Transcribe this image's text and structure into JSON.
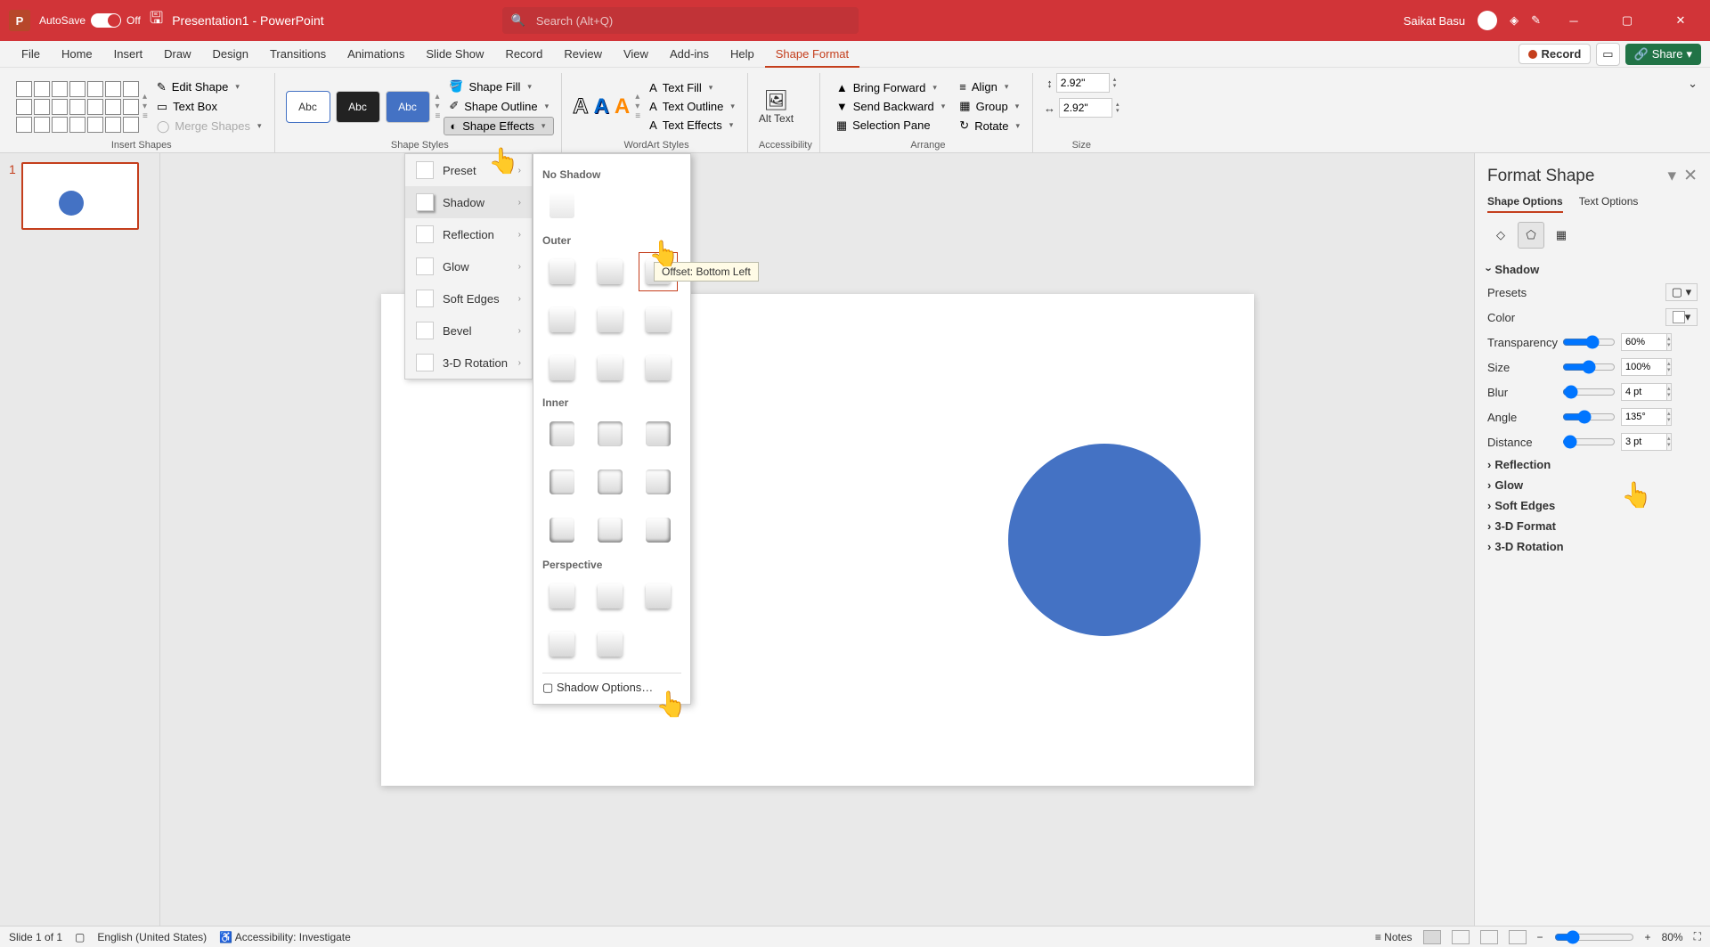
{
  "titlebar": {
    "autosave": "AutoSave",
    "autosave_state": "Off",
    "doc": "Presentation1  -  PowerPoint",
    "search_placeholder": "Search (Alt+Q)",
    "user": "Saikat Basu"
  },
  "tabs": {
    "file": "File",
    "home": "Home",
    "insert": "Insert",
    "draw": "Draw",
    "design": "Design",
    "transitions": "Transitions",
    "animations": "Animations",
    "slideshow": "Slide Show",
    "record": "Record",
    "review": "Review",
    "view": "View",
    "addins": "Add-ins",
    "help": "Help",
    "shapeformat": "Shape Format",
    "record_btn": "Record",
    "share_btn": "Share"
  },
  "ribbon": {
    "insert_shapes": "Insert Shapes",
    "edit_shape": "Edit Shape",
    "text_box": "Text Box",
    "merge_shapes": "Merge Shapes",
    "shape_styles": "Shape Styles",
    "shape_fill": "Shape Fill",
    "shape_outline": "Shape Outline",
    "shape_effects": "Shape Effects",
    "abc": "Abc",
    "wordart_styles": "WordArt Styles",
    "text_fill": "Text Fill",
    "text_outline": "Text Outline",
    "text_effects": "Text Effects",
    "accessibility": "Accessibility",
    "alt_text": "Alt Text",
    "arrange": "Arrange",
    "bring_forward": "Bring Forward",
    "send_backward": "Send Backward",
    "selection_pane": "Selection Pane",
    "align": "Align",
    "group": "Group",
    "rotate": "Rotate",
    "size": "Size",
    "height": "2.92\"",
    "width": "2.92\""
  },
  "fx_menu": {
    "preset": "Preset",
    "shadow": "Shadow",
    "reflection": "Reflection",
    "glow": "Glow",
    "soft_edges": "Soft Edges",
    "bevel": "Bevel",
    "rotation_3d": "3-D Rotation"
  },
  "shadow_panel": {
    "no_shadow": "No Shadow",
    "outer": "Outer",
    "inner": "Inner",
    "perspective": "Perspective",
    "shadow_options": "Shadow Options…",
    "tooltip": "Offset: Bottom Left"
  },
  "format_pane": {
    "title": "Format Shape",
    "shape_options": "Shape Options",
    "text_options": "Text Options",
    "shadow": "Shadow",
    "presets": "Presets",
    "color": "Color",
    "transparency": "Transparency",
    "transparency_v": "60%",
    "size": "Size",
    "size_v": "100%",
    "blur": "Blur",
    "blur_v": "4 pt",
    "angle": "Angle",
    "angle_v": "135°",
    "distance": "Distance",
    "distance_v": "3 pt",
    "reflection": "Reflection",
    "glow": "Glow",
    "soft_edges": "Soft Edges",
    "format3d": "3-D Format",
    "rotation3d": "3-D Rotation"
  },
  "statusbar": {
    "slide": "Slide 1 of 1",
    "lang": "English (United States)",
    "access": "Accessibility: Investigate",
    "notes": "Notes",
    "zoom": "80%"
  },
  "thumb": {
    "num": "1"
  }
}
